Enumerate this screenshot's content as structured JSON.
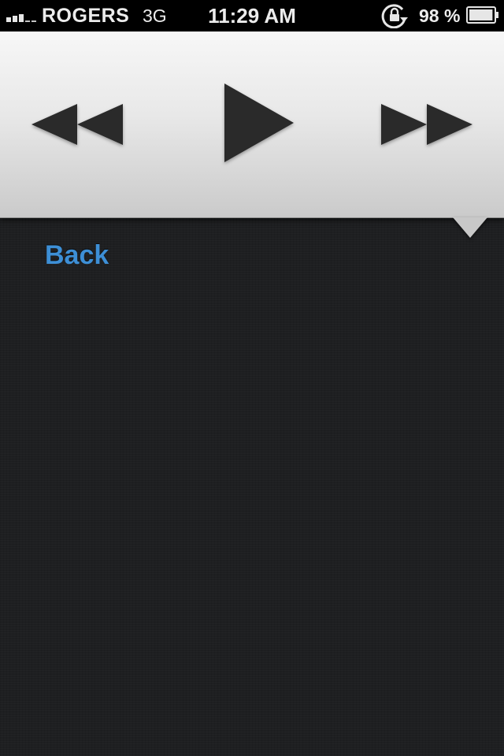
{
  "status_bar": {
    "carrier": "ROGERS",
    "network": "3G",
    "time": "11:29 AM",
    "battery_percent": "98 %",
    "signal_bars_filled": 3,
    "signal_bars_total": 5,
    "battery_level": 0.98,
    "icons": [
      "signal-strength-icon",
      "rotation-lock-icon",
      "battery-icon"
    ]
  },
  "media_controls": {
    "rewind": {
      "icon": "rewind-icon"
    },
    "play": {
      "icon": "play-icon"
    },
    "fast_forward": {
      "icon": "fast-forward-icon"
    }
  },
  "navigation": {
    "back_label": "Back"
  },
  "colors": {
    "link": "#3d8fd6",
    "control_glyph": "#2b2b2b",
    "background": "#1e1f21",
    "status_bar": "#000000"
  }
}
